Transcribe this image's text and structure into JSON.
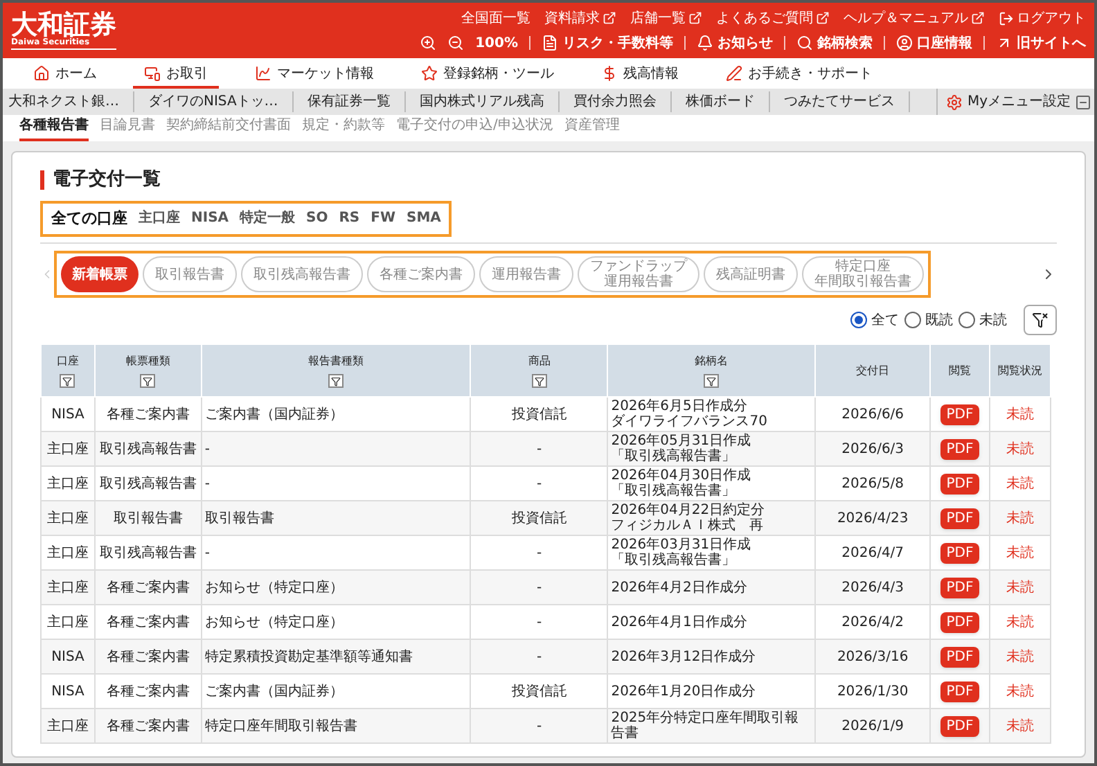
{
  "header": {
    "logo": "大和証券",
    "logo_sub": "Daiwa Securities",
    "top_links": [
      {
        "label": "全国面一覧",
        "external": false
      },
      {
        "label": "資料請求",
        "external": true
      },
      {
        "label": "店舗一覧",
        "external": true
      },
      {
        "label": "よくあるご質問",
        "external": true
      },
      {
        "label": "ヘルプ＆マニュアル",
        "external": true
      },
      {
        "label": "ログアウト",
        "external": false
      }
    ],
    "zoom": "100%",
    "tools": [
      "リスク・手数料等",
      "お知らせ",
      "銘柄検索",
      "口座情報",
      "旧サイトへ"
    ]
  },
  "main_nav": [
    {
      "label": "ホーム",
      "selected": false
    },
    {
      "label": "お取引",
      "selected": true
    },
    {
      "label": "マーケット情報",
      "selected": false
    },
    {
      "label": "登録銘柄・ツール",
      "selected": false
    },
    {
      "label": "残高情報",
      "selected": false
    },
    {
      "label": "お手続き・サポート",
      "selected": false
    }
  ],
  "sub_nav": [
    "大和ネクスト銀…",
    "ダイワのNISAトッ…",
    "保有証券一覧",
    "国内株式リアル残高",
    "買付余力照会",
    "株価ボード",
    "つみたてサービス"
  ],
  "my_menu": "Myメニュー設定",
  "tabs": [
    {
      "label": "各種報告書",
      "selected": true
    },
    {
      "label": "目論見書",
      "selected": false
    },
    {
      "label": "契約締結前交付書面",
      "selected": false
    },
    {
      "label": "規定・約款等",
      "selected": false
    },
    {
      "label": "電子交付の申込/申込状況",
      "selected": false
    },
    {
      "label": "資産管理",
      "selected": false
    }
  ],
  "title": "電子交付一覧",
  "account_tabs": [
    {
      "label": "全ての口座",
      "selected": true
    },
    {
      "label": "主口座",
      "selected": false
    },
    {
      "label": "NISA",
      "selected": false
    },
    {
      "label": "特定一般",
      "selected": false
    },
    {
      "label": "SO",
      "selected": false
    },
    {
      "label": "RS",
      "selected": false
    },
    {
      "label": "FW",
      "selected": false
    },
    {
      "label": "SMA",
      "selected": false
    }
  ],
  "chips": [
    {
      "label": "新着帳票",
      "selected": true
    },
    {
      "label": "取引報告書",
      "selected": false
    },
    {
      "label": "取引残高報告書",
      "selected": false
    },
    {
      "label": "各種ご案内書",
      "selected": false
    },
    {
      "label": "運用報告書",
      "selected": false
    },
    {
      "label": [
        "ファンドラップ",
        "運用報告書"
      ],
      "selected": false
    },
    {
      "label": "残高証明書",
      "selected": false
    },
    {
      "label": [
        "特定口座",
        "年間取引報告書"
      ],
      "selected": false
    }
  ],
  "read_filter": [
    {
      "label": "全て",
      "selected": true
    },
    {
      "label": "既読",
      "selected": false
    },
    {
      "label": "未読",
      "selected": false
    }
  ],
  "table": {
    "columns": [
      {
        "label": "口座",
        "filter": true
      },
      {
        "label": "帳票種類",
        "filter": true
      },
      {
        "label": "報告書種類",
        "filter": true
      },
      {
        "label": "商品",
        "filter": true
      },
      {
        "label": "銘柄名",
        "filter": true
      },
      {
        "label": "交付日",
        "filter": false
      },
      {
        "label": "閲覧",
        "filter": false
      },
      {
        "label": "閲覧状況",
        "filter": false
      }
    ],
    "rows": [
      [
        "NISA",
        "各種ご案内書",
        "ご案内書（国内証券）",
        "投資信託",
        [
          "2026年6月5日作成分",
          "ダイワライフバランス70"
        ],
        "2026/6/6",
        "PDF",
        "未読"
      ],
      [
        "主口座",
        "取引残高報告書",
        "-",
        "-",
        [
          "2026年05月31日作成",
          "「取引残高報告書」"
        ],
        "2026/6/3",
        "PDF",
        "未読"
      ],
      [
        "主口座",
        "取引残高報告書",
        "-",
        "-",
        [
          "2026年04月30日作成",
          "「取引残高報告書」"
        ],
        "2026/5/8",
        "PDF",
        "未読"
      ],
      [
        "主口座",
        "取引報告書",
        "取引報告書",
        "投資信託",
        [
          "2026年04月22日約定分",
          "フィジカルＡＩ株式　再"
        ],
        "2026/4/23",
        "PDF",
        "未読"
      ],
      [
        "主口座",
        "取引残高報告書",
        "-",
        "-",
        [
          "2026年03月31日作成",
          "「取引残高報告書」"
        ],
        "2026/4/7",
        "PDF",
        "未読"
      ],
      [
        "主口座",
        "各種ご案内書",
        "お知らせ（特定口座）",
        "-",
        "2026年4月2日作成分",
        "2026/4/3",
        "PDF",
        "未読"
      ],
      [
        "主口座",
        "各種ご案内書",
        "お知らせ（特定口座）",
        "-",
        "2026年4月1日作成分",
        "2026/4/2",
        "PDF",
        "未読"
      ],
      [
        "NISA",
        "各種ご案内書",
        "特定累積投資勘定基準額等通知書",
        "-",
        "2026年3月12日作成分",
        "2026/3/16",
        "PDF",
        "未読"
      ],
      [
        "NISA",
        "各種ご案内書",
        "ご案内書（国内証券）",
        "投資信託",
        "2026年1月20日作成分",
        "2026/1/30",
        "PDF",
        "未読"
      ],
      [
        "主口座",
        "各種ご案内書",
        "特定口座年間取引報告書",
        "-",
        "2025年分特定口座年間取引報告書",
        "2026/1/9",
        "PDF",
        "未読"
      ]
    ]
  }
}
